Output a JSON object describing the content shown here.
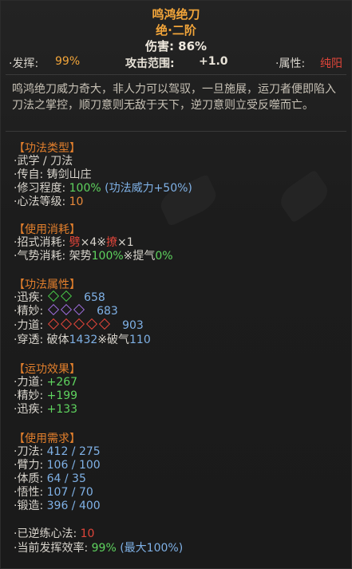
{
  "header": {
    "title": "鸣鸿绝刀",
    "rank": "绝·二阶",
    "damage": "伤害: 86%"
  },
  "stats": {
    "fahui_label": "·发挥:",
    "fahui_value": "99%",
    "range_label": "攻击范围:",
    "range_value": "+1.0",
    "attr_label": "·属性:",
    "attr_value": "纯阳"
  },
  "description": "鸣鸿绝刀威力奇大，非人力可以驾驭，一旦施展，运刀者便即陷入刀法之掌控，顺刀意则无敌于天下，逆刀意则立受反噬而亡。",
  "skill_type": {
    "title": "【功法类型】",
    "line1": "·武学 / 刀法",
    "line2": "·传自: 铸剑山庄",
    "line3_label": "·修习程度:",
    "line3_value": "100%",
    "line3_extra": "(功法威力+50%)",
    "line4_label": "·心法等级:",
    "line4_value": "10"
  },
  "cost": {
    "title": "【使用消耗】",
    "line1_label": "·招式消耗:",
    "line1_a": "劈",
    "line1_b": "×4※",
    "line1_c": "撩",
    "line1_d": "×1",
    "line2_label": "·气势消耗:",
    "line2_a": "架势",
    "line2_b": "100%",
    "line2_c": "※提气",
    "line2_d": "0%"
  },
  "attrs": {
    "title": "【功法属性】",
    "speed_label": "·迅疾:",
    "speed_value": "658",
    "skill_label": "·精妙:",
    "skill_value": "683",
    "power_label": "·力道:",
    "power_value": "903",
    "pierce_label": "·穿透:",
    "pierce_a": "破体",
    "pierce_b": "1432",
    "pierce_c": "※破气",
    "pierce_d": "110"
  },
  "effects": {
    "title": "【运功效果】",
    "power_label": "·力道:",
    "power_value": "+267",
    "skill_label": "·精妙:",
    "skill_value": "+199",
    "speed_label": "·迅疾:",
    "speed_value": "+133"
  },
  "requirements": {
    "title": "【使用需求】",
    "rows": [
      {
        "label": "·刀法:",
        "value": "412 / 275"
      },
      {
        "label": "·臂力:",
        "value": "106 / 100"
      },
      {
        "label": "·体质:",
        "value": "64 / 35"
      },
      {
        "label": "·悟性:",
        "value": "107 / 70"
      },
      {
        "label": "·锻造:",
        "value": "396 / 400"
      }
    ]
  },
  "footer": {
    "reverse_label": "·已逆练心法:",
    "reverse_value": "10",
    "eff_label": "·当前发挥效率:",
    "eff_value": "99%",
    "eff_max": "(最大100%)"
  },
  "colors": {
    "title": "#f2a53a",
    "section": "#e27f2c",
    "green": "#5ed35e",
    "red": "#e0453a",
    "blue": "#7fb1e6"
  }
}
